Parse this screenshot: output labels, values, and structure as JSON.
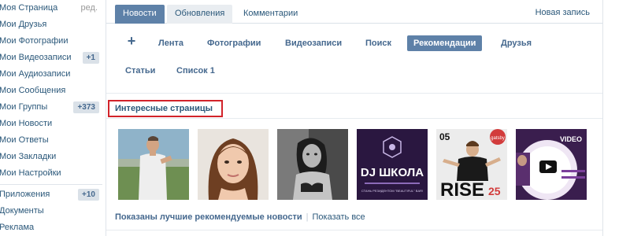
{
  "sidebar": {
    "items": [
      {
        "label": "Моя Страница",
        "extra": "ред."
      },
      {
        "label": "Мои Друзья"
      },
      {
        "label": "Мои Фотографии"
      },
      {
        "label": "Мои Видеозаписи",
        "badge": "+1"
      },
      {
        "label": "Мои Аудиозаписи"
      },
      {
        "label": "Мои Сообщения"
      },
      {
        "label": "Мои Группы",
        "badge": "+373"
      },
      {
        "label": "Мои Новости"
      },
      {
        "label": "Мои Ответы"
      },
      {
        "label": "Мои Закладки"
      },
      {
        "label": "Мои Настройки"
      }
    ],
    "items2": [
      {
        "label": "Приложения",
        "badge": "+10"
      },
      {
        "label": "Документы"
      },
      {
        "label": "Реклама"
      }
    ]
  },
  "tabs": [
    {
      "label": "Новости",
      "state": "active"
    },
    {
      "label": "Обновления",
      "state": "light"
    },
    {
      "label": "Комментарии",
      "state": "plain"
    }
  ],
  "new_post": "Новая запись",
  "filters": {
    "plus": "+",
    "row1": [
      "Лента",
      "Фотографии",
      "Видеозаписи",
      "Поиск",
      "Рекомендации",
      "Друзья"
    ],
    "selected": "Рекомендации",
    "row2": [
      "Статьи",
      "Список 1"
    ]
  },
  "section_title": "Интересные страницы",
  "thumbs": [
    {
      "name": "man-in-white-shirt-photo"
    },
    {
      "name": "woman-portrait-photo"
    },
    {
      "name": "woman-black-white-photo"
    },
    {
      "name": "dj-school-poster",
      "text": "DJ ШКОЛА",
      "small": "СТАНЬ РЕЗИДЕНТОМ \"BEAUTIFUL\" BAR!"
    },
    {
      "name": "rise-party-poster",
      "top_num": "05",
      "text": "RISE",
      "num": "25",
      "brand": "gatsby"
    },
    {
      "name": "video-lesson-poster",
      "text": "VIDEO"
    }
  ],
  "footer": {
    "bold": "Показаны лучшие рекомендуемые новости",
    "pipe": "|",
    "link": "Показать все"
  },
  "colors": {
    "link": "#2b587a",
    "accent": "#5e81a8",
    "highlight_border": "#d2232a",
    "badge_bg": "#dae1e8"
  }
}
